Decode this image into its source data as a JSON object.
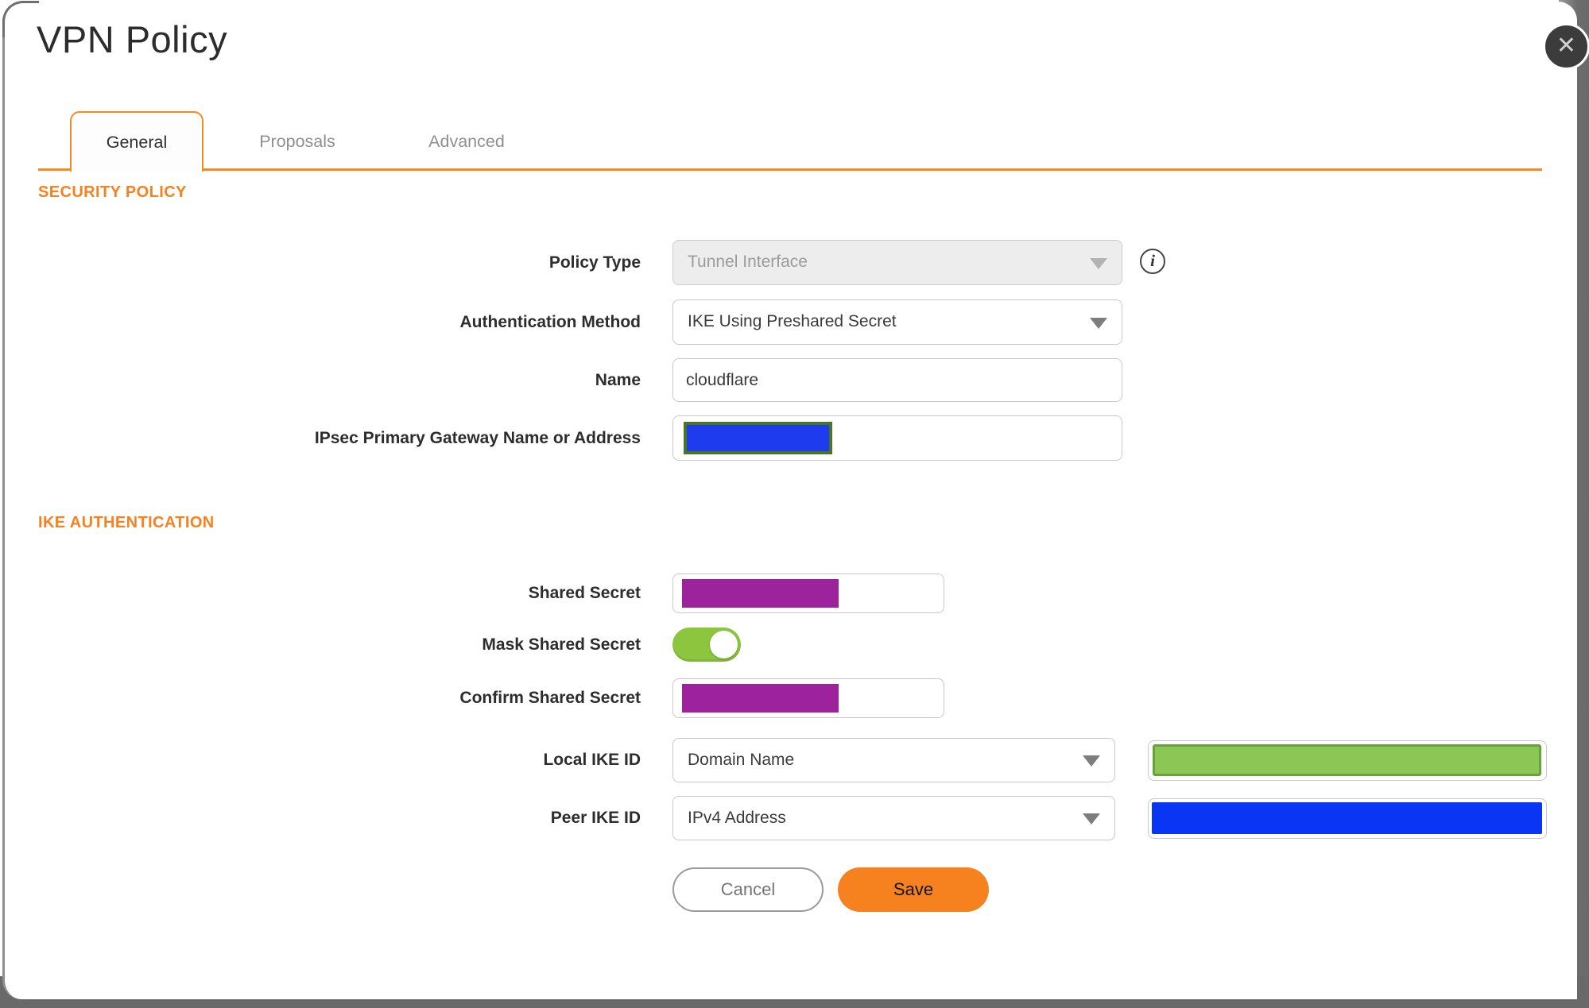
{
  "window": {
    "title": "VPN Policy"
  },
  "icons": {
    "close": "✕",
    "info": "i"
  },
  "tabs": [
    {
      "label": "General",
      "active": true
    },
    {
      "label": "Proposals",
      "active": false
    },
    {
      "label": "Advanced",
      "active": false
    }
  ],
  "security_policy": {
    "heading": "SECURITY POLICY",
    "policy_type": {
      "label": "Policy Type",
      "value": "Tunnel Interface",
      "disabled": true
    },
    "auth_method": {
      "label": "Authentication Method",
      "value": "IKE Using Preshared Secret"
    },
    "name": {
      "label": "Name",
      "value": "cloudflare"
    },
    "gateway": {
      "label": "IPsec Primary Gateway Name or Address",
      "value": "",
      "redacted": true
    }
  },
  "ike_authentication": {
    "heading": "IKE AUTHENTICATION",
    "shared_secret": {
      "label": "Shared Secret",
      "value": "",
      "redacted": true
    },
    "mask_shared_secret": {
      "label": "Mask Shared Secret",
      "enabled": true
    },
    "confirm_shared_secret": {
      "label": "Confirm Shared Secret",
      "value": "",
      "redacted": true
    },
    "local_ike_id": {
      "label": "Local IKE ID",
      "value": "Domain Name",
      "id_value_redacted": true
    },
    "peer_ike_id": {
      "label": "Peer IKE ID",
      "value": "IPv4 Address",
      "id_value_redacted": true
    }
  },
  "buttons": {
    "cancel": "Cancel",
    "save": "Save"
  },
  "colors": {
    "accent_orange": "#F6821F",
    "tab_border_orange": "#F68B1F",
    "toggle_green": "#8CC63F",
    "redaction_purple": "#9D239C",
    "redaction_blue": "#0A36F3",
    "redaction_green": "#8CC655",
    "redaction_green_border": "#69A13A",
    "gateway_redaction_border": "#4A7522",
    "save_button_orange": "#F6821F"
  }
}
